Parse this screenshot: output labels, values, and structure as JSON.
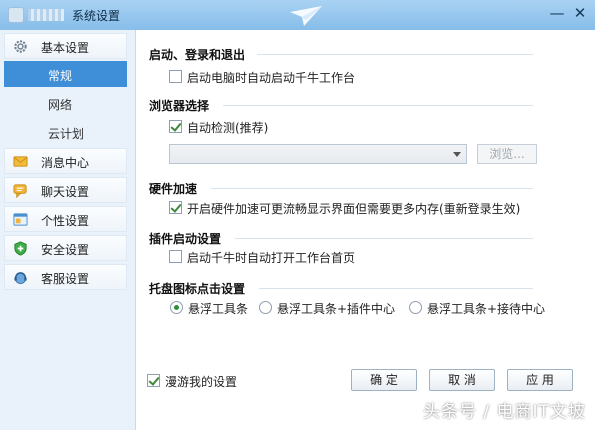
{
  "window": {
    "title": "系统设置"
  },
  "sidebar": {
    "categories": [
      {
        "label": "基本设置",
        "icon": "gear-icon"
      },
      {
        "label": "消息中心",
        "icon": "envelope-icon"
      },
      {
        "label": "聊天设置",
        "icon": "chat-bubble-icon"
      },
      {
        "label": "个性设置",
        "icon": "window-icon"
      },
      {
        "label": "安全设置",
        "icon": "shield-icon"
      },
      {
        "label": "客服设置",
        "icon": "headset-icon"
      }
    ],
    "subitems": [
      {
        "label": "常规",
        "active": true
      },
      {
        "label": "网络",
        "active": false
      },
      {
        "label": "云计划",
        "active": false
      }
    ],
    "active_color": "#3f8fd8"
  },
  "content": {
    "startup": {
      "title": "启动、登录和退出",
      "option": {
        "label": "启动电脑时自动启动千牛工作台",
        "checked": false
      }
    },
    "browser": {
      "title": "浏览器选择",
      "option": {
        "label": "自动检测(推荐)",
        "checked": true
      },
      "combo_value": "",
      "browse_label": "浏览..."
    },
    "hardware": {
      "title": "硬件加速",
      "option": {
        "label": "开启硬件加速可更流畅显示界面但需要更多内存(重新登录生效)",
        "checked": true
      }
    },
    "plugin": {
      "title": "插件启动设置",
      "option": {
        "label": "启动千牛时自动打开工作台首页",
        "checked": false
      }
    },
    "tray": {
      "title": "托盘图标点击设置",
      "radios": [
        {
          "label": "悬浮工具条",
          "selected": true
        },
        {
          "label": "悬浮工具条+插件中心",
          "selected": false
        },
        {
          "label": "悬浮工具条+接待中心",
          "selected": false
        }
      ]
    }
  },
  "footer": {
    "roaming": {
      "label": "漫游我的设置",
      "checked": true
    },
    "ok_label": "确 定",
    "cancel_label": "取 消",
    "apply_label": "应 用"
  },
  "watermark": "头条号 / 电商IT文坡"
}
